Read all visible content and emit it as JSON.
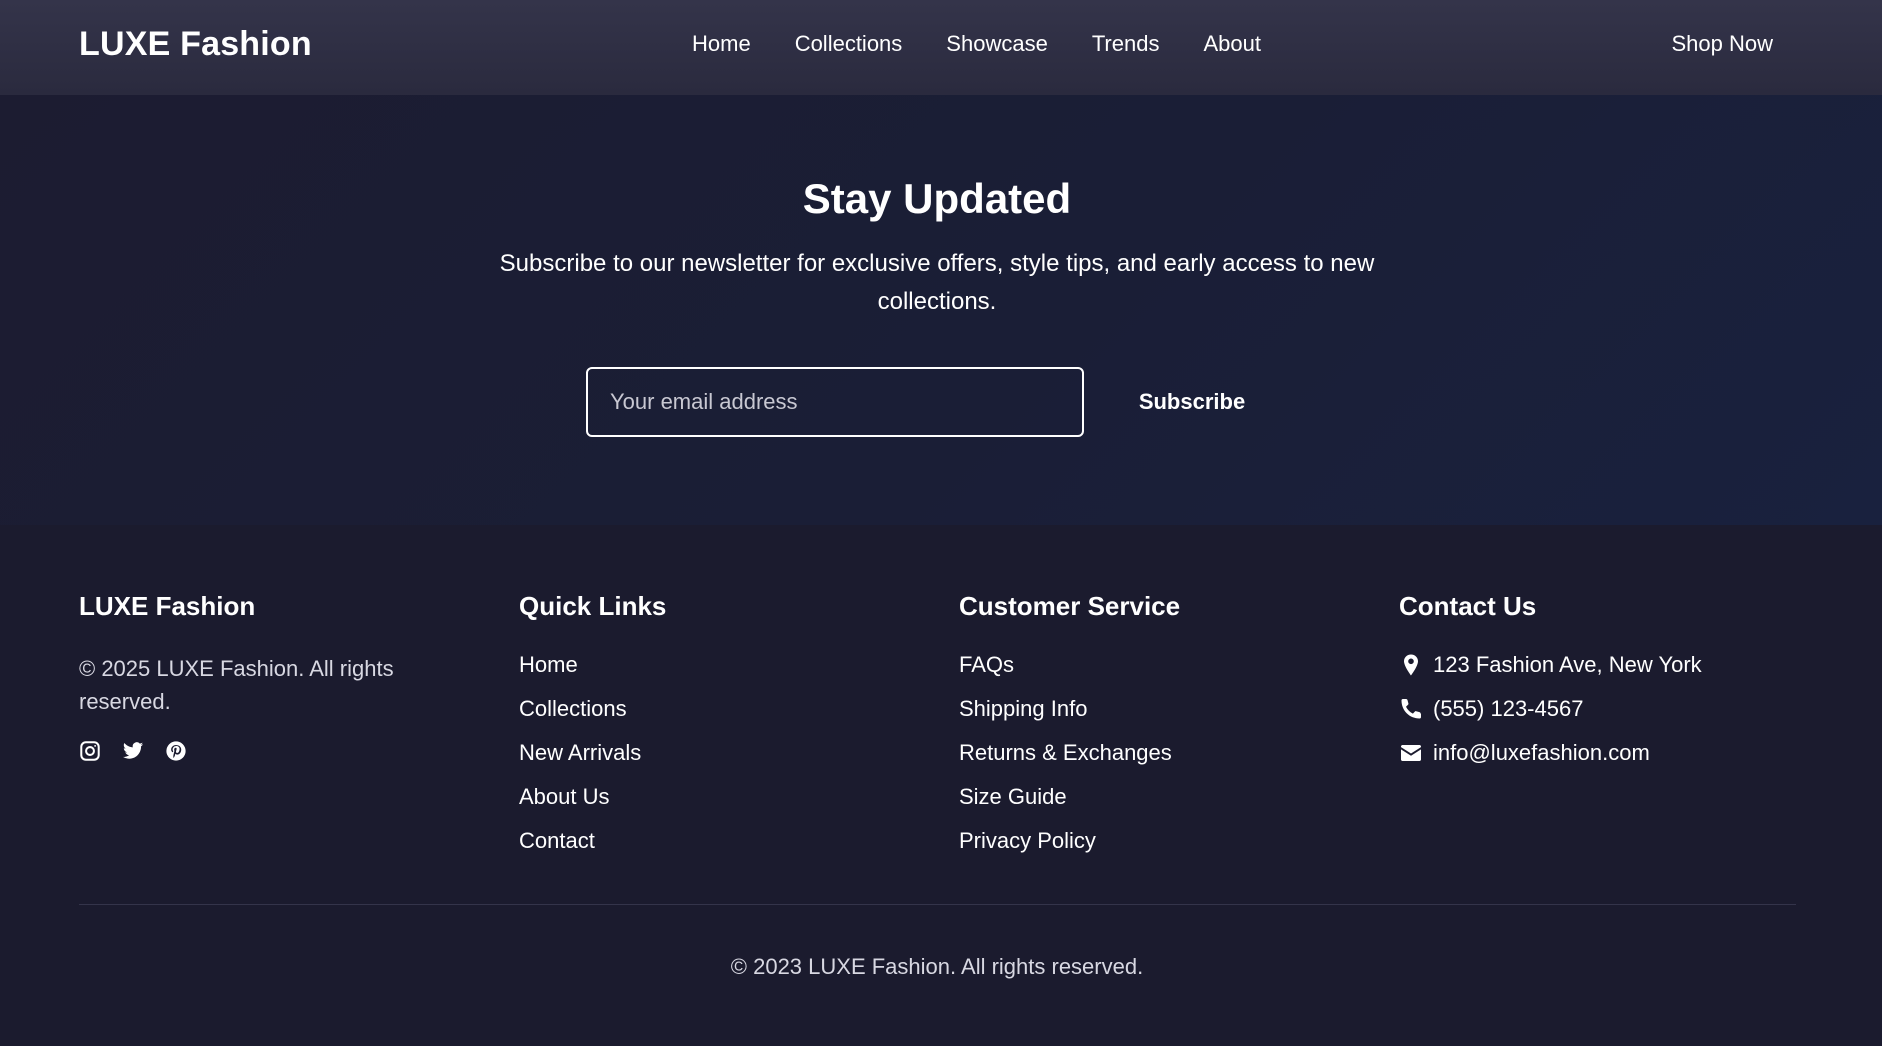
{
  "header": {
    "brand": "LUXE Fashion",
    "nav": [
      "Home",
      "Collections",
      "Showcase",
      "Trends",
      "About"
    ],
    "cta": "Shop Now"
  },
  "newsletter": {
    "title": "Stay Updated",
    "subtitle": "Subscribe to our newsletter for exclusive offers, style tips, and early access to new collections.",
    "email_placeholder": "Your email address",
    "subscribe_label": "Subscribe"
  },
  "footer": {
    "brand_col": {
      "title": "LUXE Fashion",
      "copyright": "© 2025 LUXE Fashion. All rights reserved.",
      "socials": [
        "instagram-icon",
        "twitter-icon",
        "pinterest-icon"
      ]
    },
    "quick_links": {
      "title": "Quick Links",
      "items": [
        "Home",
        "Collections",
        "New Arrivals",
        "About Us",
        "Contact"
      ]
    },
    "customer_service": {
      "title": "Customer Service",
      "items": [
        "FAQs",
        "Shipping Info",
        "Returns & Exchanges",
        "Size Guide",
        "Privacy Policy"
      ]
    },
    "contact": {
      "title": "Contact Us",
      "address": "123 Fashion Ave, New York",
      "phone": "(555) 123-4567",
      "email": "info@luxefashion.com"
    },
    "bottom_copyright": "© 2023 LUXE Fashion. All rights reserved."
  },
  "colors": {
    "header_bg": "#2f2f44",
    "page_bg": "#1b1b2e",
    "text": "#ffffff"
  }
}
